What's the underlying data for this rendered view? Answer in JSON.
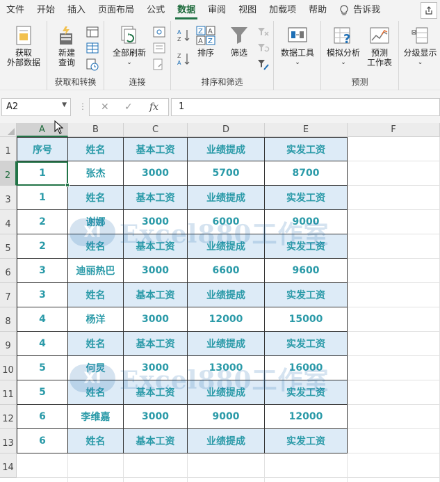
{
  "menubar": {
    "tabs": [
      "文件",
      "开始",
      "插入",
      "页面布局",
      "公式",
      "数据",
      "审阅",
      "视图",
      "加载项",
      "帮助"
    ],
    "active_tab": "数据",
    "tell_me": "告诉我"
  },
  "ribbon": {
    "get_external_data": {
      "line1": "获取",
      "line2": "外部数据"
    },
    "new_query": {
      "line1": "新建",
      "line2": "查询"
    },
    "group_get_transform": "获取和转换",
    "refresh_all": "全部刷新",
    "group_connections": "连接",
    "sort": "排序",
    "filter": "筛选",
    "group_sort_filter": "排序和筛选",
    "data_tools": "数据工具",
    "what_if": "模拟分析",
    "forecast": {
      "line1": "预测",
      "line2": "工作表"
    },
    "group_forecast": "预测",
    "outline": "分级显示"
  },
  "formula_bar": {
    "name_box": "A2",
    "value": "1"
  },
  "columns": [
    "A",
    "B",
    "C",
    "D",
    "E",
    "F"
  ],
  "rows": [
    "1",
    "2",
    "3",
    "4",
    "5",
    "6",
    "7",
    "8",
    "9",
    "10",
    "11",
    "12",
    "13",
    "14"
  ],
  "selected_cell": {
    "col": "A",
    "row": "2"
  },
  "table": {
    "header": [
      "序号",
      "姓名",
      "基本工资",
      "业绩提成",
      "实发工资"
    ],
    "rows": [
      [
        "1",
        "张杰",
        "3000",
        "5700",
        "8700"
      ],
      [
        "1",
        "姓名",
        "基本工资",
        "业绩提成",
        "实发工资"
      ],
      [
        "2",
        "谢娜",
        "3000",
        "6000",
        "9000"
      ],
      [
        "2",
        "姓名",
        "基本工资",
        "业绩提成",
        "实发工资"
      ],
      [
        "3",
        "迪丽热巴",
        "3000",
        "6600",
        "9600"
      ],
      [
        "3",
        "姓名",
        "基本工资",
        "业绩提成",
        "实发工资"
      ],
      [
        "4",
        "杨洋",
        "3000",
        "12000",
        "15000"
      ],
      [
        "4",
        "姓名",
        "基本工资",
        "业绩提成",
        "实发工资"
      ],
      [
        "5",
        "何炅",
        "3000",
        "13000",
        "16000"
      ],
      [
        "5",
        "姓名",
        "基本工资",
        "业绩提成",
        "实发工资"
      ],
      [
        "6",
        "李维嘉",
        "3000",
        "9000",
        "12000"
      ],
      [
        "6",
        "姓名",
        "基本工资",
        "业绩提成",
        "实发工资"
      ]
    ]
  },
  "watermark": {
    "logo": "XI",
    "text": "Excel880工作室"
  },
  "colors": {
    "accent": "#217346",
    "cell_text": "#2a9aa8",
    "header_fill": "#ddebf7"
  }
}
